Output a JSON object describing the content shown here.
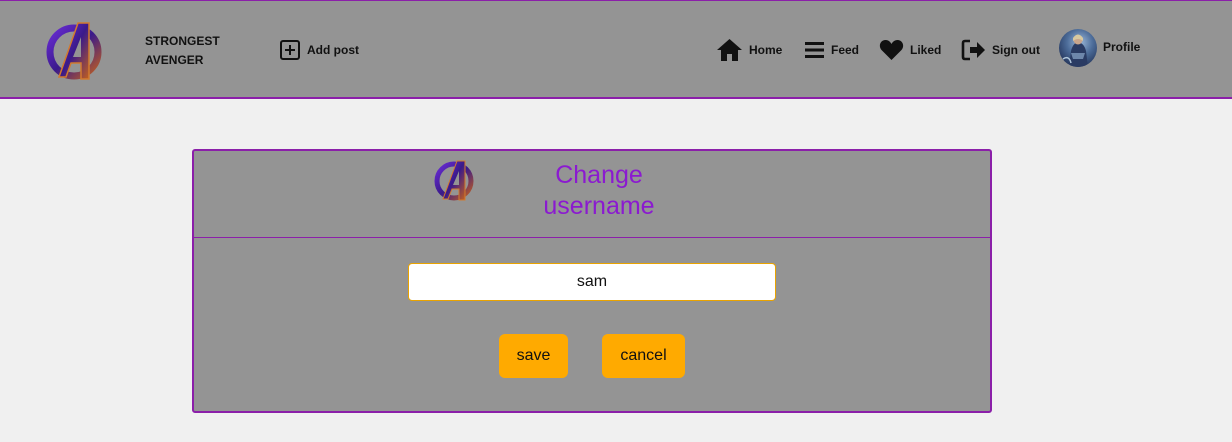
{
  "header": {
    "brand_name": "STRONGEST AVENGER",
    "logo_icon": "avengers-logo-icon",
    "nav": {
      "add_post": "Add post",
      "home": "Home",
      "feed": "Feed",
      "liked": "Liked",
      "sign_out": "Sign out",
      "profile": "Profile"
    }
  },
  "dialog": {
    "title": "Change username",
    "logo_icon": "avengers-logo-icon",
    "username_value": "sam",
    "save_label": "save",
    "cancel_label": "cancel"
  },
  "colors": {
    "accent_purple": "#8b1fa9",
    "title_purple": "#8b1ad0",
    "button_orange": "#ffaa00",
    "panel_gray": "#949494",
    "page_bg": "#f0f0f0"
  }
}
